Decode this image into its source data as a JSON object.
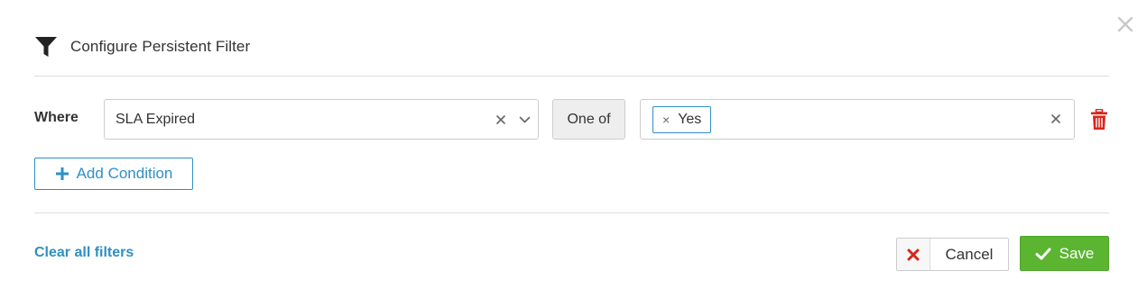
{
  "dialog": {
    "title": "Configure Persistent Filter"
  },
  "condition": {
    "where_label": "Where",
    "field_value": "SLA Expired",
    "operator": "One of",
    "values": [
      "Yes"
    ]
  },
  "actions": {
    "add_condition_label": "Add Condition",
    "clear_all_label": "Clear all filters",
    "cancel_label": "Cancel",
    "save_label": "Save"
  },
  "icons": {
    "close": "close-icon",
    "filter": "filter-funnel-icon",
    "clear": "clear-x-icon",
    "dropdown": "chevron-down-icon",
    "delete": "trash-icon",
    "add": "plus-icon",
    "cancel": "x-icon",
    "save": "checkmark-icon"
  },
  "colors": {
    "accent": "#2e8fc6",
    "save_green": "#5cb531",
    "delete_red": "#d9261c"
  }
}
